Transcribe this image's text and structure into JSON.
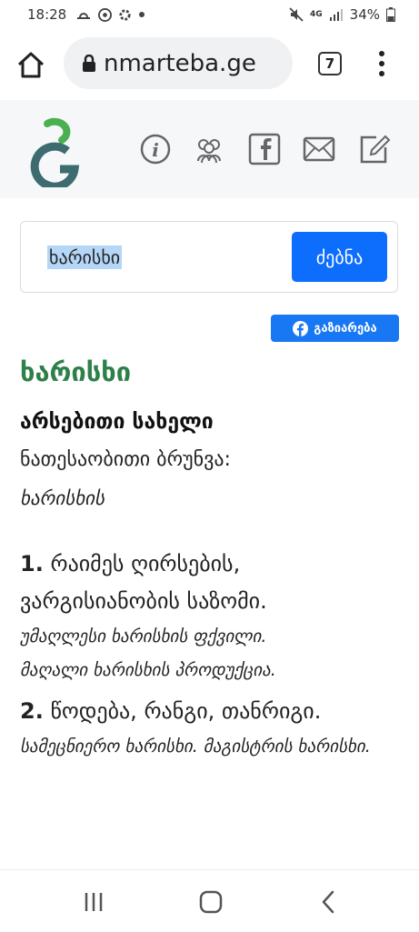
{
  "status_bar": {
    "time": "18:28",
    "battery": "34%",
    "network": "4G"
  },
  "browser": {
    "url": "nmarteba.ge",
    "tab_count": "7"
  },
  "search": {
    "query": "ხარისხი",
    "button_label": "ძებნა"
  },
  "share": {
    "label": "გაზიარება"
  },
  "entry": {
    "word": "ხარისხი",
    "part_of_speech": "არსებითი სახელი",
    "genitive_label": "ნათესაობითი ბრუნვა:",
    "genitive_value": "ხარისხის",
    "definitions": [
      {
        "number": "1.",
        "text": "რაიმეს ღირსების, ვარგისიანობის საზომი.",
        "examples": [
          "უმაღლესი ხარისხის ფქვილი.",
          "მაღალი ხარისხის პროდუქცია."
        ]
      },
      {
        "number": "2.",
        "text": "წოდება, რანგი, თანრიგი.",
        "examples": [
          "სამეცნიერო ხარისხი. მაგისტრის ხარისხი."
        ]
      }
    ]
  },
  "colors": {
    "accent": "#0d6efd",
    "word": "#2e8049",
    "facebook": "#1877f2",
    "logo_green": "#4caf50",
    "logo_teal": "#3d6b6e"
  }
}
